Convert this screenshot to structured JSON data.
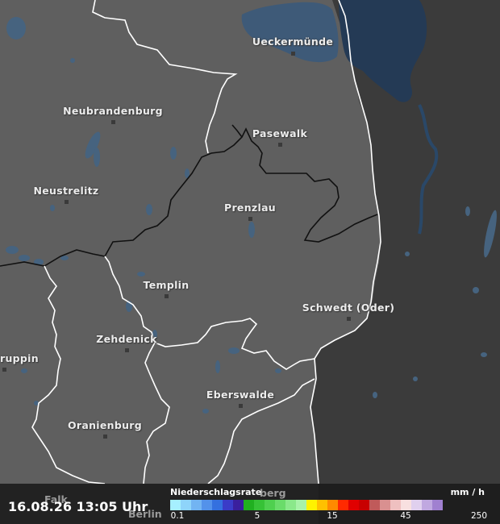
{
  "map": {
    "colors": {
      "land": "#5f5f5f",
      "poland_mask": "#3b3b3b",
      "water": "#3e5a78",
      "border_de": "#ffffff",
      "border_state": "#111111"
    },
    "cities": [
      {
        "key": "ueckermuende",
        "name": "Ueckermünde"
      },
      {
        "key": "neubrandenburg",
        "name": "Neubrandenburg"
      },
      {
        "key": "pasewalk",
        "name": "Pasewalk"
      },
      {
        "key": "neustrelitz",
        "name": "Neustrelitz"
      },
      {
        "key": "prenzlau",
        "name": "Prenzlau"
      },
      {
        "key": "templin",
        "name": "Templin"
      },
      {
        "key": "schwedt",
        "name": "Schwedt (Oder)"
      },
      {
        "key": "zehdenick",
        "name": "Zehdenick"
      },
      {
        "key": "ruppin",
        "name": "ruppin"
      },
      {
        "key": "eberswalde",
        "name": "Eberswalde"
      },
      {
        "key": "oranienburg",
        "name": "Oranienburg"
      }
    ],
    "hidden_labels": {
      "berlin": "Berlin",
      "berg": "berg",
      "falk": "Falk"
    }
  },
  "footer": {
    "timestamp": "16.08.26 13:05 Uhr",
    "legend": {
      "title": "Niederschlagsrate",
      "unit": "mm / h",
      "ticks": [
        "0.1",
        "5",
        "15",
        "45",
        "250"
      ],
      "colors": [
        "#a6f0ff",
        "#8ed4fa",
        "#72b4f2",
        "#5392ea",
        "#3470df",
        "#3a3cc8",
        "#3a1f9e",
        "#20b020",
        "#36c236",
        "#4fd04f",
        "#6adc6a",
        "#8ae88a",
        "#a8f2a8",
        "#fff200",
        "#ffc000",
        "#ff8a00",
        "#ff2a00",
        "#e00000",
        "#c80000",
        "#c05a5a",
        "#d99090",
        "#efc0c0",
        "#f8e0e0",
        "#e0d0ee",
        "#c0a8e0",
        "#a080d0"
      ]
    }
  }
}
